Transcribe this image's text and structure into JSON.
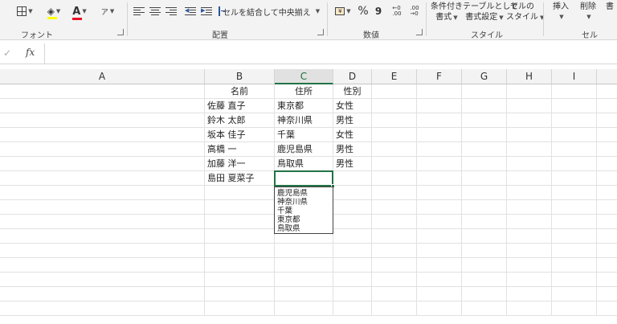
{
  "ribbon": {
    "groups": {
      "font": "フォント",
      "alignment": "配置",
      "number": "数値",
      "styles": "スタイル",
      "cells": "セル"
    },
    "merge_center": "セルを結合して中央揃え",
    "percent": "%",
    "comma": "9",
    "cond_format_line1": "条件付き",
    "cond_format_line2": "書式",
    "table_format_line1": "テーブルとして",
    "table_format_line2": "書式設定",
    "cell_style_line1": "セルの",
    "cell_style_line2": "スタイル",
    "insert": "挿入",
    "delete": "削除",
    "format_partial": "書"
  },
  "formula_bar": {
    "fx": "fx",
    "value": ""
  },
  "columns": [
    "A",
    "B",
    "C",
    "D",
    "E",
    "F",
    "G",
    "H",
    "I"
  ],
  "selected_column": "C",
  "rows": [
    {
      "B": "名前",
      "C": "住所",
      "D": "性別"
    },
    {
      "B": "佐藤 直子",
      "C": "東京都",
      "D": "女性"
    },
    {
      "B": "鈴木 太郎",
      "C": "神奈川県",
      "D": "男性"
    },
    {
      "B": "坂本 佳子",
      "C": "千葉",
      "D": "女性"
    },
    {
      "B": "高橋 一",
      "C": "鹿児島県",
      "D": "男性"
    },
    {
      "B": "加藤 洋一",
      "C": "鳥取県",
      "D": "男性"
    },
    {
      "B": "島田 夏菜子",
      "C": "",
      "D": ""
    }
  ],
  "autocomplete": [
    "鹿児島県",
    "神奈川県",
    "千葉",
    "東京都",
    "鳥取県"
  ],
  "colors": {
    "accent": "#217346",
    "font_color_bar": "#e81123",
    "fill_color_bar": "#ffff00"
  }
}
